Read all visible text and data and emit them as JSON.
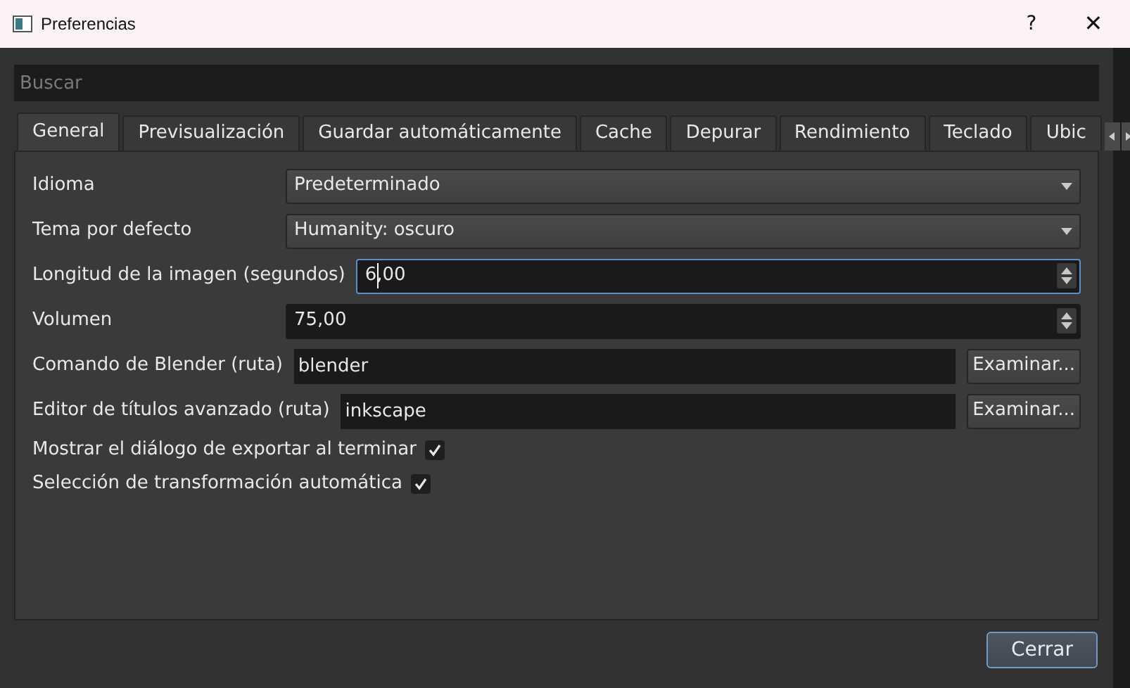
{
  "window": {
    "title": "Preferencias",
    "help": "?",
    "close": "✕"
  },
  "search": {
    "placeholder": "Buscar"
  },
  "tabs": [
    {
      "label": "General",
      "selected": true
    },
    {
      "label": "Previsualización",
      "selected": false
    },
    {
      "label": "Guardar automáticamente",
      "selected": false
    },
    {
      "label": "Cache",
      "selected": false
    },
    {
      "label": "Depurar",
      "selected": false
    },
    {
      "label": "Rendimiento",
      "selected": false
    },
    {
      "label": "Teclado",
      "selected": false
    },
    {
      "label": "Ubic",
      "selected": false
    }
  ],
  "settings": [
    {
      "kind": "combo",
      "label": "Idioma",
      "value": "Predeterminado"
    },
    {
      "kind": "combo",
      "label": "Tema por defecto",
      "value": "Humanity: oscuro"
    },
    {
      "kind": "spin",
      "label": "Longitud de la imagen (segundos)",
      "value": "6,00",
      "focused": true
    },
    {
      "kind": "spin",
      "label": "Volumen",
      "value": "75,00",
      "focused": false
    },
    {
      "kind": "path",
      "label": "Comando de Blender (ruta)",
      "value": "blender",
      "button": "Examinar..."
    },
    {
      "kind": "path",
      "label": "Editor de títulos avanzado (ruta)",
      "value": "inkscape",
      "button": "Examinar..."
    },
    {
      "kind": "check",
      "label": "Mostrar el diálogo de exportar al terminar",
      "checked": true
    },
    {
      "kind": "check",
      "label": "Selección de transformación automática",
      "checked": true
    }
  ],
  "close_button": "Cerrar"
}
